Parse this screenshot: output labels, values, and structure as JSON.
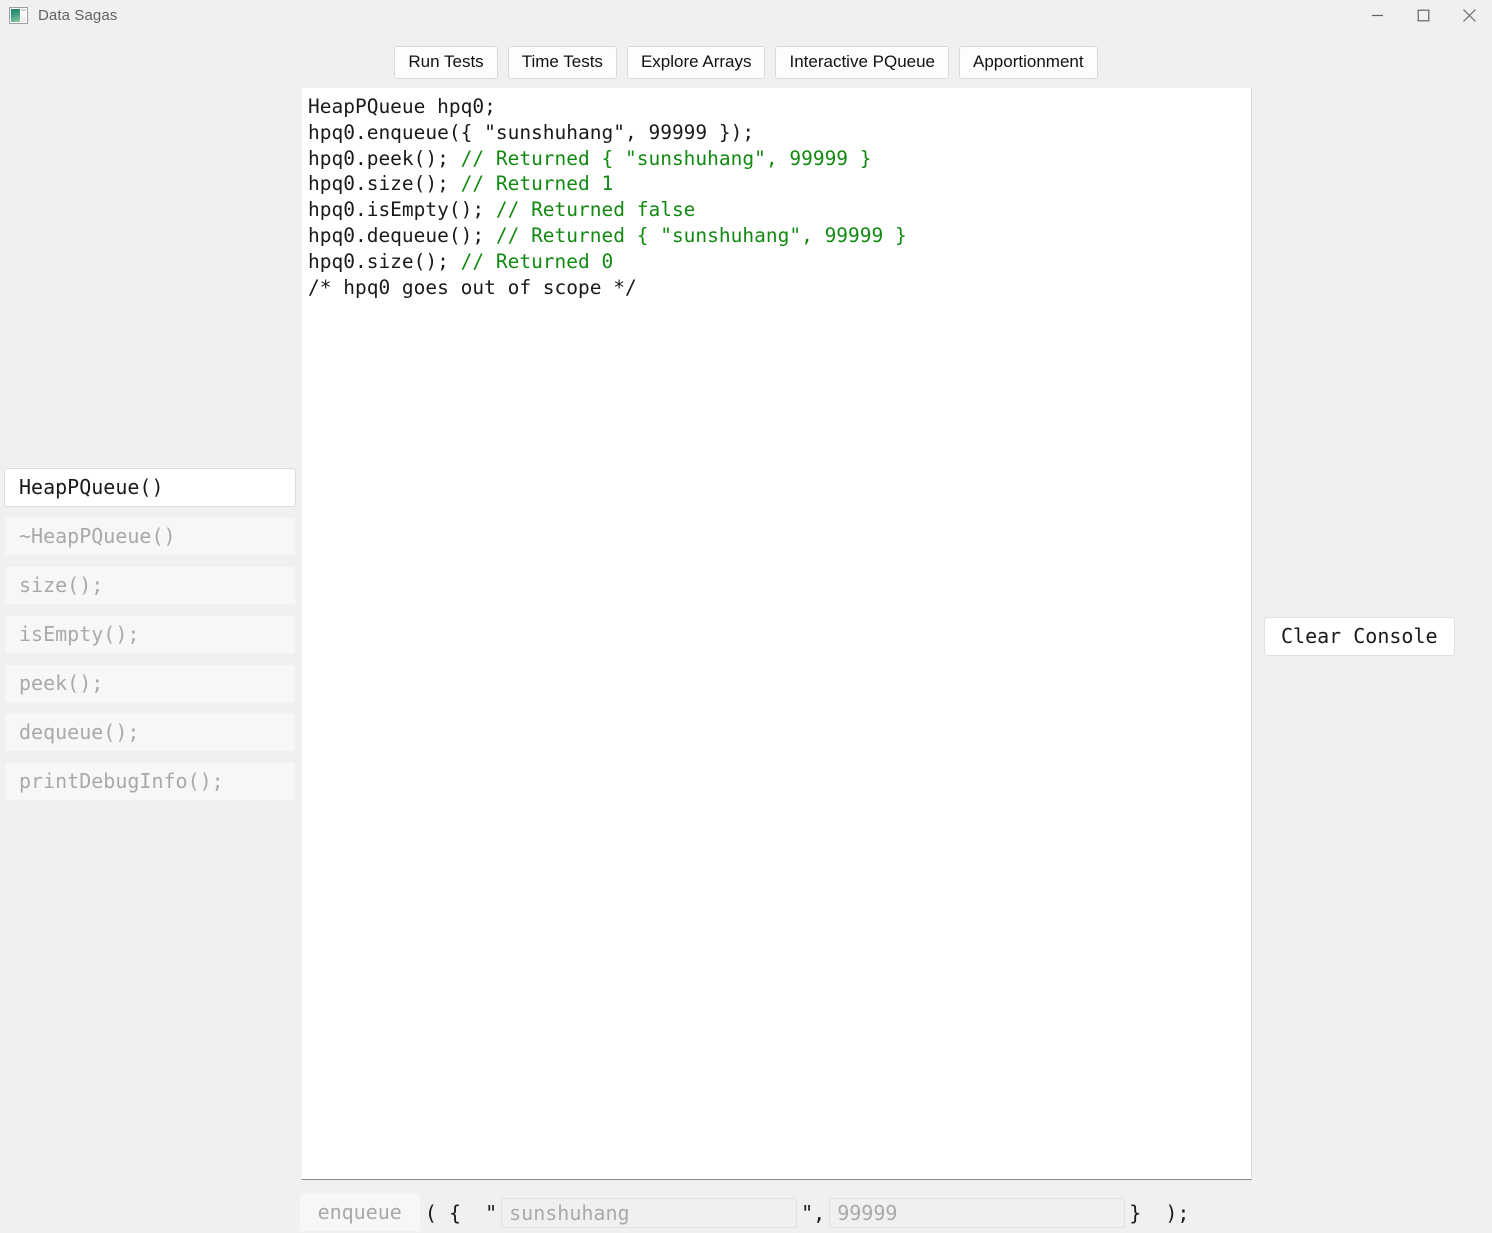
{
  "window": {
    "title": "Data Sagas",
    "icon": "app-window-icon",
    "controls": [
      {
        "name": "minimize",
        "glyph": "minimize-icon"
      },
      {
        "name": "maximize",
        "glyph": "maximize-icon"
      },
      {
        "name": "close",
        "glyph": "close-icon"
      }
    ]
  },
  "toolbar": {
    "buttons": [
      {
        "label": "Run Tests"
      },
      {
        "label": "Time Tests"
      },
      {
        "label": "Explore Arrays"
      },
      {
        "label": "Interactive PQueue"
      },
      {
        "label": "Apportionment"
      }
    ]
  },
  "console": {
    "lines": [
      [
        {
          "text": "HeapPQueue hpq0;",
          "style": "code"
        }
      ],
      [
        {
          "text": "hpq0.enqueue({ \"sunshuhang\", 99999 });",
          "style": "code"
        }
      ],
      [
        {
          "text": "hpq0.peek(); ",
          "style": "code"
        },
        {
          "text": "// Returned { \"sunshuhang\", 99999 }",
          "style": "comment"
        }
      ],
      [
        {
          "text": "hpq0.size(); ",
          "style": "code"
        },
        {
          "text": "// Returned 1",
          "style": "comment"
        }
      ],
      [
        {
          "text": "hpq0.isEmpty(); ",
          "style": "code"
        },
        {
          "text": "// Returned false",
          "style": "comment"
        }
      ],
      [
        {
          "text": "hpq0.dequeue(); ",
          "style": "code"
        },
        {
          "text": "// Returned { \"sunshuhang\", 99999 }",
          "style": "comment"
        }
      ],
      [
        {
          "text": "hpq0.size(); ",
          "style": "code"
        },
        {
          "text": "// Returned 0",
          "style": "comment"
        }
      ],
      [
        {
          "text": "/* hpq0 goes out of scope */",
          "style": "code"
        }
      ]
    ],
    "code_color": "#1a1a1a",
    "comment_color": "#128a12"
  },
  "sidebar": {
    "buttons": [
      {
        "label": "HeapPQueue()",
        "enabled": true,
        "name": "constructor"
      },
      {
        "label": "~HeapPQueue()",
        "enabled": false,
        "name": "destructor"
      },
      {
        "label": "size();",
        "enabled": false,
        "name": "size"
      },
      {
        "label": "isEmpty();",
        "enabled": false,
        "name": "is-empty"
      },
      {
        "label": "peek();",
        "enabled": false,
        "name": "peek"
      },
      {
        "label": "dequeue();",
        "enabled": false,
        "name": "dequeue"
      },
      {
        "label": "printDebugInfo();",
        "enabled": false,
        "name": "print-debug-info"
      }
    ]
  },
  "clear_console": {
    "label": "Clear Console"
  },
  "bottom_bar": {
    "enqueue_label": "enqueue",
    "sep_open": "( {  \"",
    "sep_mid": "\",",
    "sep_close": "}  );",
    "name_input": {
      "value": "",
      "placeholder": "sunshuhang"
    },
    "priority_input": {
      "value": "",
      "placeholder": "99999"
    }
  }
}
